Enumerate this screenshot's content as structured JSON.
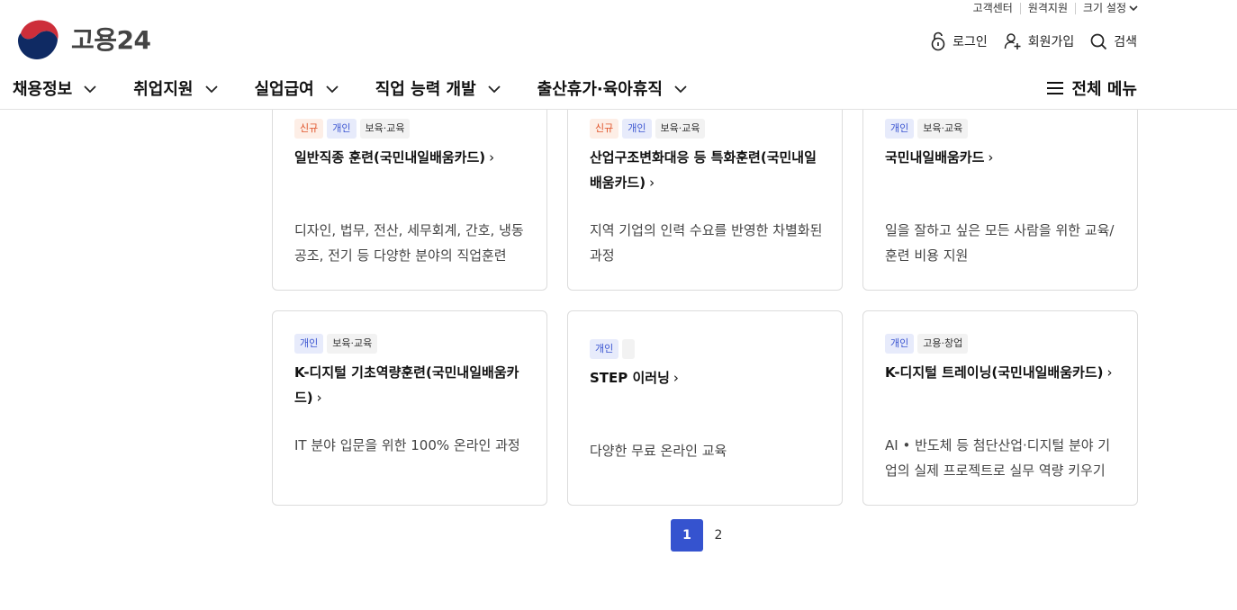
{
  "header": {
    "util_links": [
      "고객센터",
      "원격지원",
      "크기 설정"
    ],
    "logo_text": "고용24",
    "account": {
      "login": "로그인",
      "signup": "회원가입",
      "search": "검색"
    },
    "gnb": [
      "채용정보",
      "취업지원",
      "실업급여",
      "직업 능력 개발",
      "출산휴가·육아휴직"
    ],
    "all_menu": "전체 메뉴"
  },
  "cards": [
    {
      "tags": [
        {
          "text": "신규",
          "type": "new"
        },
        {
          "text": "개인",
          "type": "ind"
        },
        {
          "text": "보육·교육",
          "type": "cat"
        }
      ],
      "title": "일반직종 훈련(국민내일배움카드)",
      "desc": "디자인, 법무, 전산, 세무회계, 간호, 냉동공조, 전기 등 다양한 분야의 직업훈련"
    },
    {
      "tags": [
        {
          "text": "신규",
          "type": "new"
        },
        {
          "text": "개인",
          "type": "ind"
        },
        {
          "text": "보육·교육",
          "type": "cat"
        }
      ],
      "title": "산업구조변화대응 등 특화훈련(국민내일배움카드)",
      "desc": "지역 기업의 인력 수요를 반영한 차별화된 과정"
    },
    {
      "tags": [
        {
          "text": "개인",
          "type": "ind"
        },
        {
          "text": "보육·교육",
          "type": "cat"
        }
      ],
      "title": "국민내일배움카드",
      "desc": "일을 잘하고 싶은 모든 사람을 위한 교육/훈련 비용 지원"
    },
    {
      "tags": [
        {
          "text": "개인",
          "type": "ind"
        },
        {
          "text": "보육·교육",
          "type": "cat"
        }
      ],
      "title": "K-디지털 기초역량훈련(국민내일배움카드)",
      "desc": "IT 분야 입문을 위한 100% 온라인 과정"
    },
    {
      "tags": [
        {
          "text": "개인",
          "type": "ind"
        },
        {
          "text": "",
          "type": "empty"
        }
      ],
      "title": "STEP 이러닝",
      "desc": "다양한 무료 온라인 교육"
    },
    {
      "tags": [
        {
          "text": "개인",
          "type": "ind"
        },
        {
          "text": "고용·창업",
          "type": "cat"
        }
      ],
      "title": "K-디지털 트레이닝(국민내일배움카드)",
      "desc": "AI • 반도체 등 첨단산업·디지털 분야 기업의 실제 프로젝트로 실무 역량 키우기"
    }
  ],
  "pagination": {
    "pages": [
      "1",
      "2"
    ],
    "current": "1"
  },
  "colors": {
    "accent": "#3553cf",
    "new_tag": "#e0542a",
    "individual_tag": "#3b55d1"
  },
  "icons": [
    "taegeuk-logo-icon",
    "lock-icon",
    "add-user-icon",
    "search-icon",
    "chevron-down-icon",
    "hamburger-icon",
    "chevron-right-icon"
  ]
}
